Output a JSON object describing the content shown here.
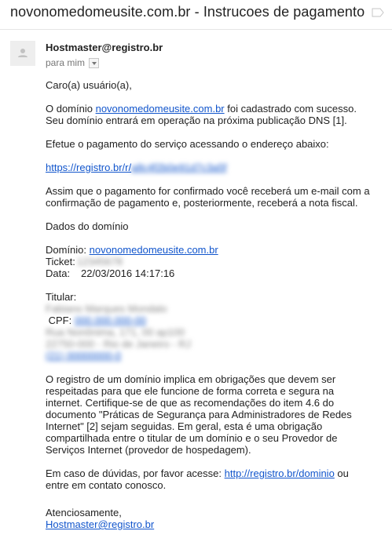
{
  "email": {
    "subject": "novonomedomeusite.com.br - Instrucoes de pagamento",
    "sender": "Hostmaster@registro.br",
    "to_label": "para mim",
    "body": {
      "greeting": "Caro(a) usuário(a),",
      "p1_prefix": "O domínio ",
      "p1_domain_link": "novonomedomeusite.com.br",
      "p1_suffix": " foi cadastrado com sucesso.",
      "p1_line2": "Seu domínio entrará em operação na próxima publicação DNS [1].",
      "p2": "Efetue o pagamento do serviço acessando o endereço abaixo:",
      "payment_link_visible": "https://registro.br/r/",
      "payment_link_redacted": "a8c4f2b0e91d7c3a5f",
      "p3_line1": "Assim que o pagamento for confirmado você receberá um e-mail com a",
      "p3_line2": "confirmação de pagamento e, posteriormente, receberá a nota fiscal.",
      "section_title": "Dados do domínio",
      "dominio_label": "Domínio:",
      "dominio_value": "novonomedomeusite.com.br",
      "ticket_label": "Ticket:",
      "ticket_value": "12345678",
      "data_label": "Data:",
      "data_value": "22/03/2016 14:17:16",
      "titular_label": "Titular:",
      "titular_name": "Fabiano Marques Mondalo",
      "cpf_label": "CPF:",
      "cpf_value": "000.000.000-00",
      "address_line1": "Rua Nonônima, 171, 00 ap100",
      "address_line2": "22750-000 - Rio de Janeiro - RJ",
      "phone": "(21) 00000000-0",
      "p4_line1": "O registro de um domínio implica em obrigações que devem ser",
      "p4_line2": "respeitadas para que ele funcione de forma correta e segura na",
      "p4_line3": "internet. Certifique-se de que as recomendações do item 4.6 do",
      "p4_line4": "documento \"Práticas de Segurança para Administradores de Redes",
      "p4_line5": "Internet\" [2] sejam seguidas. Em geral, esta é uma obrigação",
      "p4_line6": "compartilhada entre o titular de um domínio e o seu Provedor de",
      "p4_line7": "Serviços Internet (provedor de hospedagem).",
      "p5_prefix": "Em caso de dúvidas, por favor acesse: ",
      "p5_link": "http://registro.br/dominio",
      "p5_suffix": " ou",
      "p5_line2": "entre em contato conosco.",
      "closing": "Atenciosamente,",
      "closing_link": "Hostmaster@registro.br"
    }
  },
  "icons": {
    "subject_icon": "label-arrow-icon",
    "avatar": "person-avatar-icon",
    "dropdown": "chevron-down-icon"
  },
  "colors": {
    "link": "#1155cc",
    "meta_text": "#777777",
    "body_text": "#222222"
  }
}
